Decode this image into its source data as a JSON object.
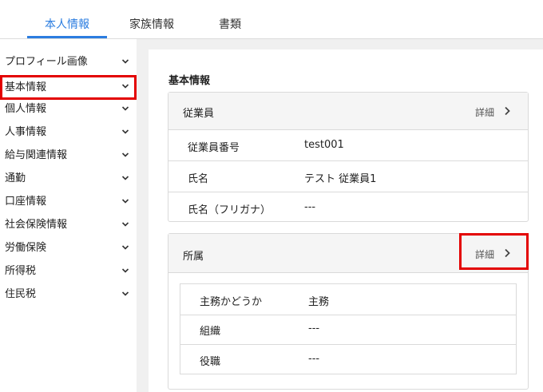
{
  "tabs": [
    {
      "label": "本人情報",
      "active": true
    },
    {
      "label": "家族情報",
      "active": false
    },
    {
      "label": "書類",
      "active": false
    }
  ],
  "sidebar": {
    "items": [
      {
        "label": "プロフィール画像"
      },
      {
        "label": "基本情報",
        "highlighted": true
      },
      {
        "label": "個人情報"
      },
      {
        "label": "人事情報"
      },
      {
        "label": "給与関連情報"
      },
      {
        "label": "通勤"
      },
      {
        "label": "口座情報"
      },
      {
        "label": "社会保険情報"
      },
      {
        "label": "労働保険"
      },
      {
        "label": "所得税"
      },
      {
        "label": "住民税"
      }
    ]
  },
  "main": {
    "section_title": "基本情報",
    "employee_card": {
      "title": "従業員",
      "detail_label": "詳細",
      "rows": [
        {
          "key": "従業員番号",
          "value": "test001"
        },
        {
          "key": "氏名",
          "value": "テスト 従業員1"
        },
        {
          "key": "氏名（フリガナ）",
          "value": "---"
        }
      ]
    },
    "affiliation_card": {
      "title": "所属",
      "detail_label": "詳細",
      "rows": [
        {
          "key": "主務かどうか",
          "value": "主務"
        },
        {
          "key": "組織",
          "value": "---"
        },
        {
          "key": "役職",
          "value": "---"
        }
      ]
    }
  },
  "colors": {
    "accent": "#2b7de0",
    "highlight": "#e30000",
    "main_bg": "#f0f0f0"
  }
}
